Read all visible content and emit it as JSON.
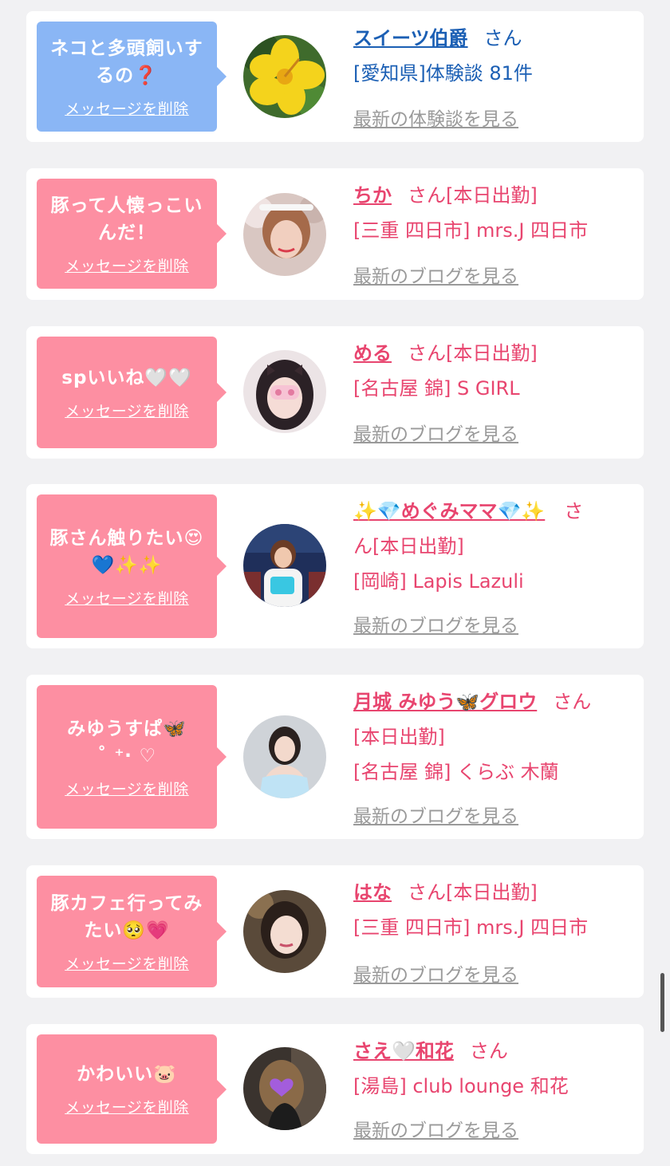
{
  "delete_label": "メッセージを削除",
  "colors": {
    "blue_bubble": "#8ab6f5",
    "pink_bubble": "#fd8fa2",
    "blue_text": "#1b5fb4",
    "pink_text": "#e8456f",
    "link_grey": "#9a9a9a"
  },
  "cards": [
    {
      "message_line1": "ネコと多頭飼いす",
      "message_line2": "るの❓",
      "name": "スイーツ伯爵",
      "honorific": "さん",
      "meta": "",
      "location_line": "[愛知県]体験談 81件",
      "more_label": "最新の体験談を見る",
      "avatar_icon": "yellow-flower-icon"
    },
    {
      "message_line1": "豚って人懐っこい",
      "message_line2": "んだ！",
      "name": "ちか",
      "honorific": "さん",
      "meta": "[本日出勤]",
      "location_line": "[三重 四日市] mrs.J 四日市",
      "more_label": "最新のブログを見る",
      "avatar_icon": "profile-photo"
    },
    {
      "message_line1": "spいいね🤍🤍",
      "message_line2": "",
      "name": "める",
      "honorific": "さん",
      "meta": "[本日出勤]",
      "location_line": "[名古屋 錦] S GIRL",
      "more_label": "最新のブログを見る",
      "avatar_icon": "profile-photo"
    },
    {
      "message_line1": "豚さん触りたい😍",
      "message_line2": "💙✨✨",
      "name": "✨💎めぐみママ💎✨",
      "honorific": "さ",
      "honorific_wrap": "ん[本日出勤]",
      "meta": "",
      "location_line": "[岡崎] Lapis Lazuli",
      "more_label": "最新のブログを見る",
      "avatar_icon": "profile-photo"
    },
    {
      "message_line1": "みゆうすぱ🦋",
      "message_line2": "˚ ⁺‧ ♡",
      "name": "月城 みゆう🦋グロウ",
      "honorific": "さん",
      "meta_wrap": "[本日出勤]",
      "meta": "",
      "location_line": "[名古屋 錦] くらぶ 木蘭",
      "more_label": "最新のブログを見る",
      "avatar_icon": "profile-photo"
    },
    {
      "message_line1": "豚カフェ行ってみ",
      "message_line2": "たい🥺💗",
      "name": "はな",
      "honorific": "さん",
      "meta": "[本日出勤]",
      "location_line": "[三重 四日市] mrs.J 四日市",
      "more_label": "最新のブログを見る",
      "avatar_icon": "profile-photo"
    },
    {
      "message_line1": "かわいい🐷",
      "message_line2": "",
      "name": "さえ🤍和花",
      "honorific": "さん",
      "meta": "",
      "location_line": "[湯島] club lounge 和花",
      "more_label": "最新のブログを見る",
      "avatar_icon": "profile-photo"
    }
  ]
}
